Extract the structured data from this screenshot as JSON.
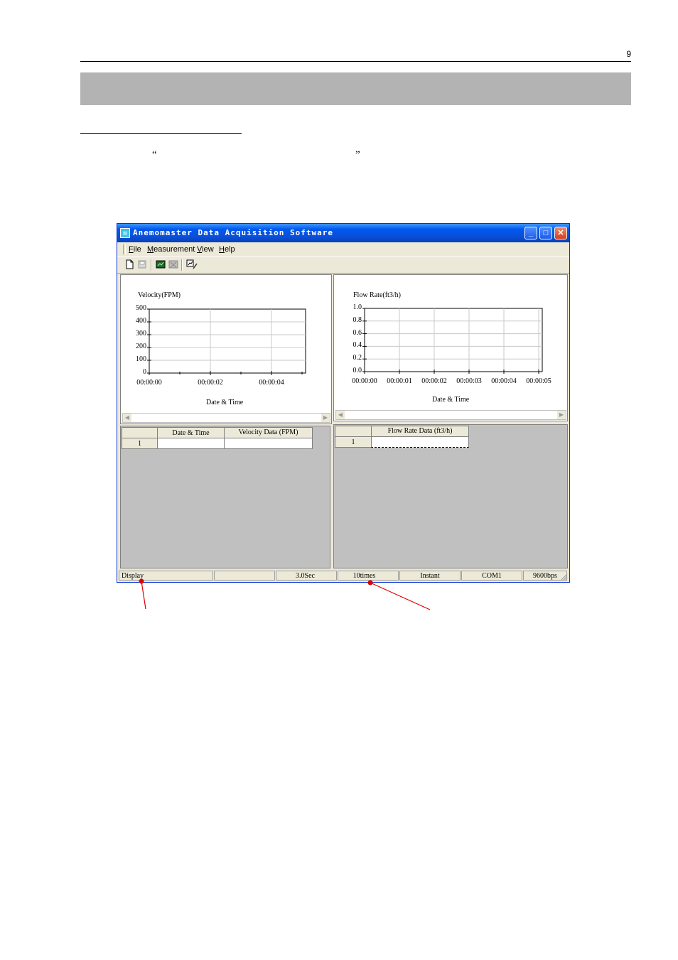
{
  "page": {
    "number": "9",
    "open_quote": "“",
    "close_quote": "”"
  },
  "window": {
    "title": "Anemomaster Data Acquisition Software",
    "menu": [
      "File",
      "Measurement",
      "View",
      "Help"
    ],
    "controls": {
      "minimize": "_",
      "maximize": "□",
      "close": "✕"
    }
  },
  "velocity_chart": {
    "title": "Velocity(FPM)",
    "xlabel": "Date & Time",
    "y_ticks": [
      "500",
      "400",
      "300",
      "200",
      "100",
      "0"
    ],
    "x_ticks": [
      "00:00:00",
      "00:00:02",
      "00:00:04"
    ]
  },
  "flow_chart": {
    "title": "Flow Rate(ft3/h)",
    "xlabel": "Date & Time",
    "y_ticks": [
      "1.0",
      "0.8",
      "0.6",
      "0.4",
      "0.2",
      "0.0"
    ],
    "x_ticks": [
      "00:00:00",
      "00:00:01",
      "00:00:02",
      "00:00:03",
      "00:00:04",
      "00:00:05"
    ]
  },
  "chart_data": [
    {
      "type": "line",
      "title": "Velocity(FPM)",
      "xlabel": "Date & Time",
      "ylabel": "",
      "x_tick_labels": [
        "00:00:00",
        "00:00:02",
        "00:00:04"
      ],
      "ylim": [
        0,
        500
      ],
      "grid": true,
      "series": []
    },
    {
      "type": "line",
      "title": "Flow Rate(ft3/h)",
      "xlabel": "Date & Time",
      "ylabel": "",
      "x_tick_labels": [
        "00:00:00",
        "00:00:01",
        "00:00:02",
        "00:00:03",
        "00:00:04",
        "00:00:05"
      ],
      "ylim": [
        0.0,
        1.0
      ],
      "grid": true,
      "series": []
    }
  ],
  "velocity_table": {
    "headers": [
      "",
      "Date & Time",
      "Velocity Data (FPM)"
    ],
    "rows": [
      [
        "1",
        "",
        ""
      ]
    ]
  },
  "flow_table": {
    "headers": [
      "",
      "Flow Rate Data (ft3/h)"
    ],
    "rows": [
      [
        "1",
        ""
      ]
    ]
  },
  "status": {
    "mode": "Display",
    "blank": "",
    "interval": "3.0Sec",
    "count": "10times",
    "type": "Instant",
    "port": "COM1",
    "baud": "9600bps"
  },
  "colors": {
    "titlebar": "#0a4fd8",
    "section_bar": "#b3b3b3",
    "annotation_arrow": "#e00000",
    "grid_background": "#c0c0c0"
  }
}
